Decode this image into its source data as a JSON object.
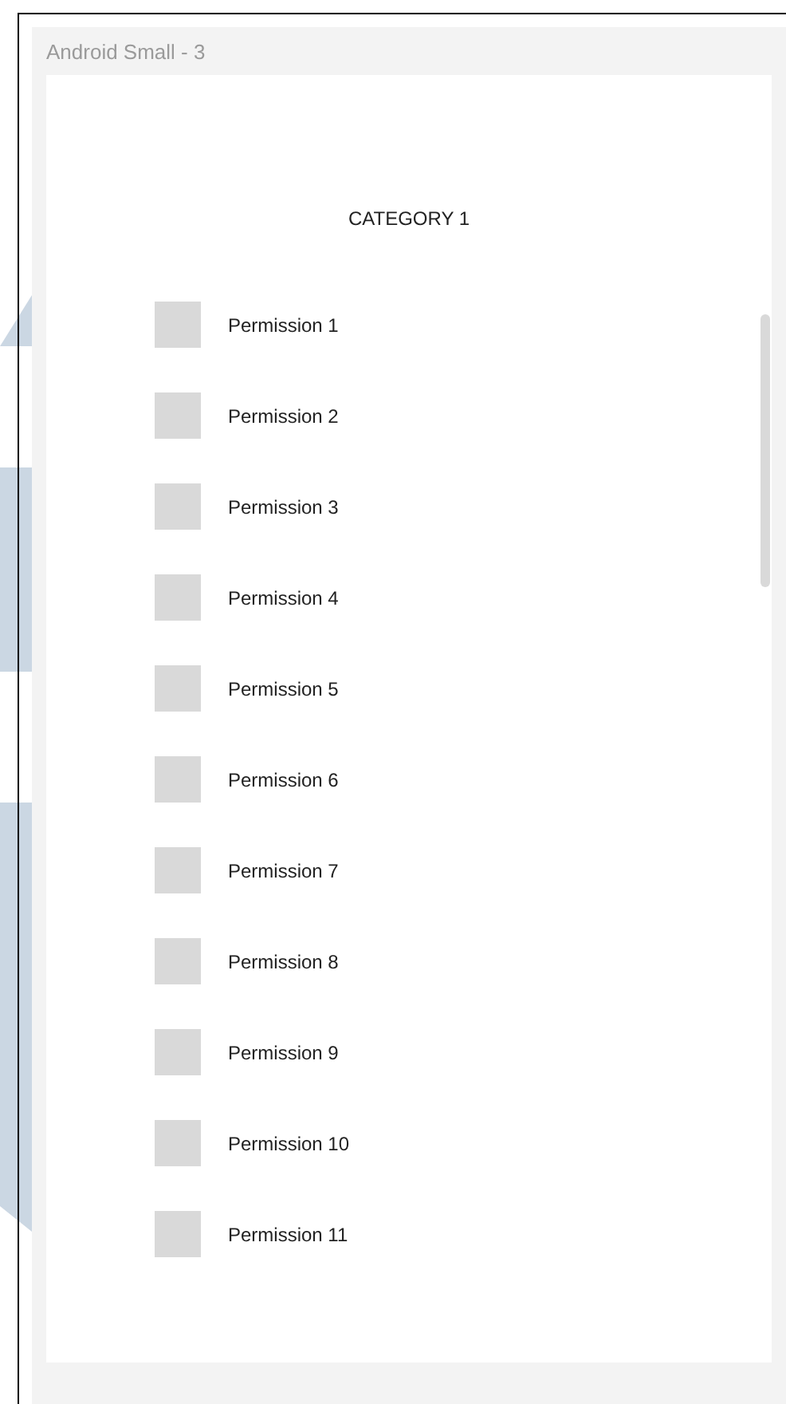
{
  "frame_label": "Android Small - 3",
  "category": "CATEGORY 1",
  "permissions": [
    {
      "label": "Permission 1",
      "checked": false
    },
    {
      "label": "Permission 2",
      "checked": false
    },
    {
      "label": "Permission 3",
      "checked": false
    },
    {
      "label": "Permission 4",
      "checked": false
    },
    {
      "label": "Permission 5",
      "checked": false
    },
    {
      "label": "Permission 6",
      "checked": false
    },
    {
      "label": "Permission 7",
      "checked": false
    },
    {
      "label": "Permission 8",
      "checked": false
    },
    {
      "label": "Permission 9",
      "checked": false
    },
    {
      "label": "Permission 10",
      "checked": false
    },
    {
      "label": "Permission 11",
      "checked": false
    }
  ]
}
